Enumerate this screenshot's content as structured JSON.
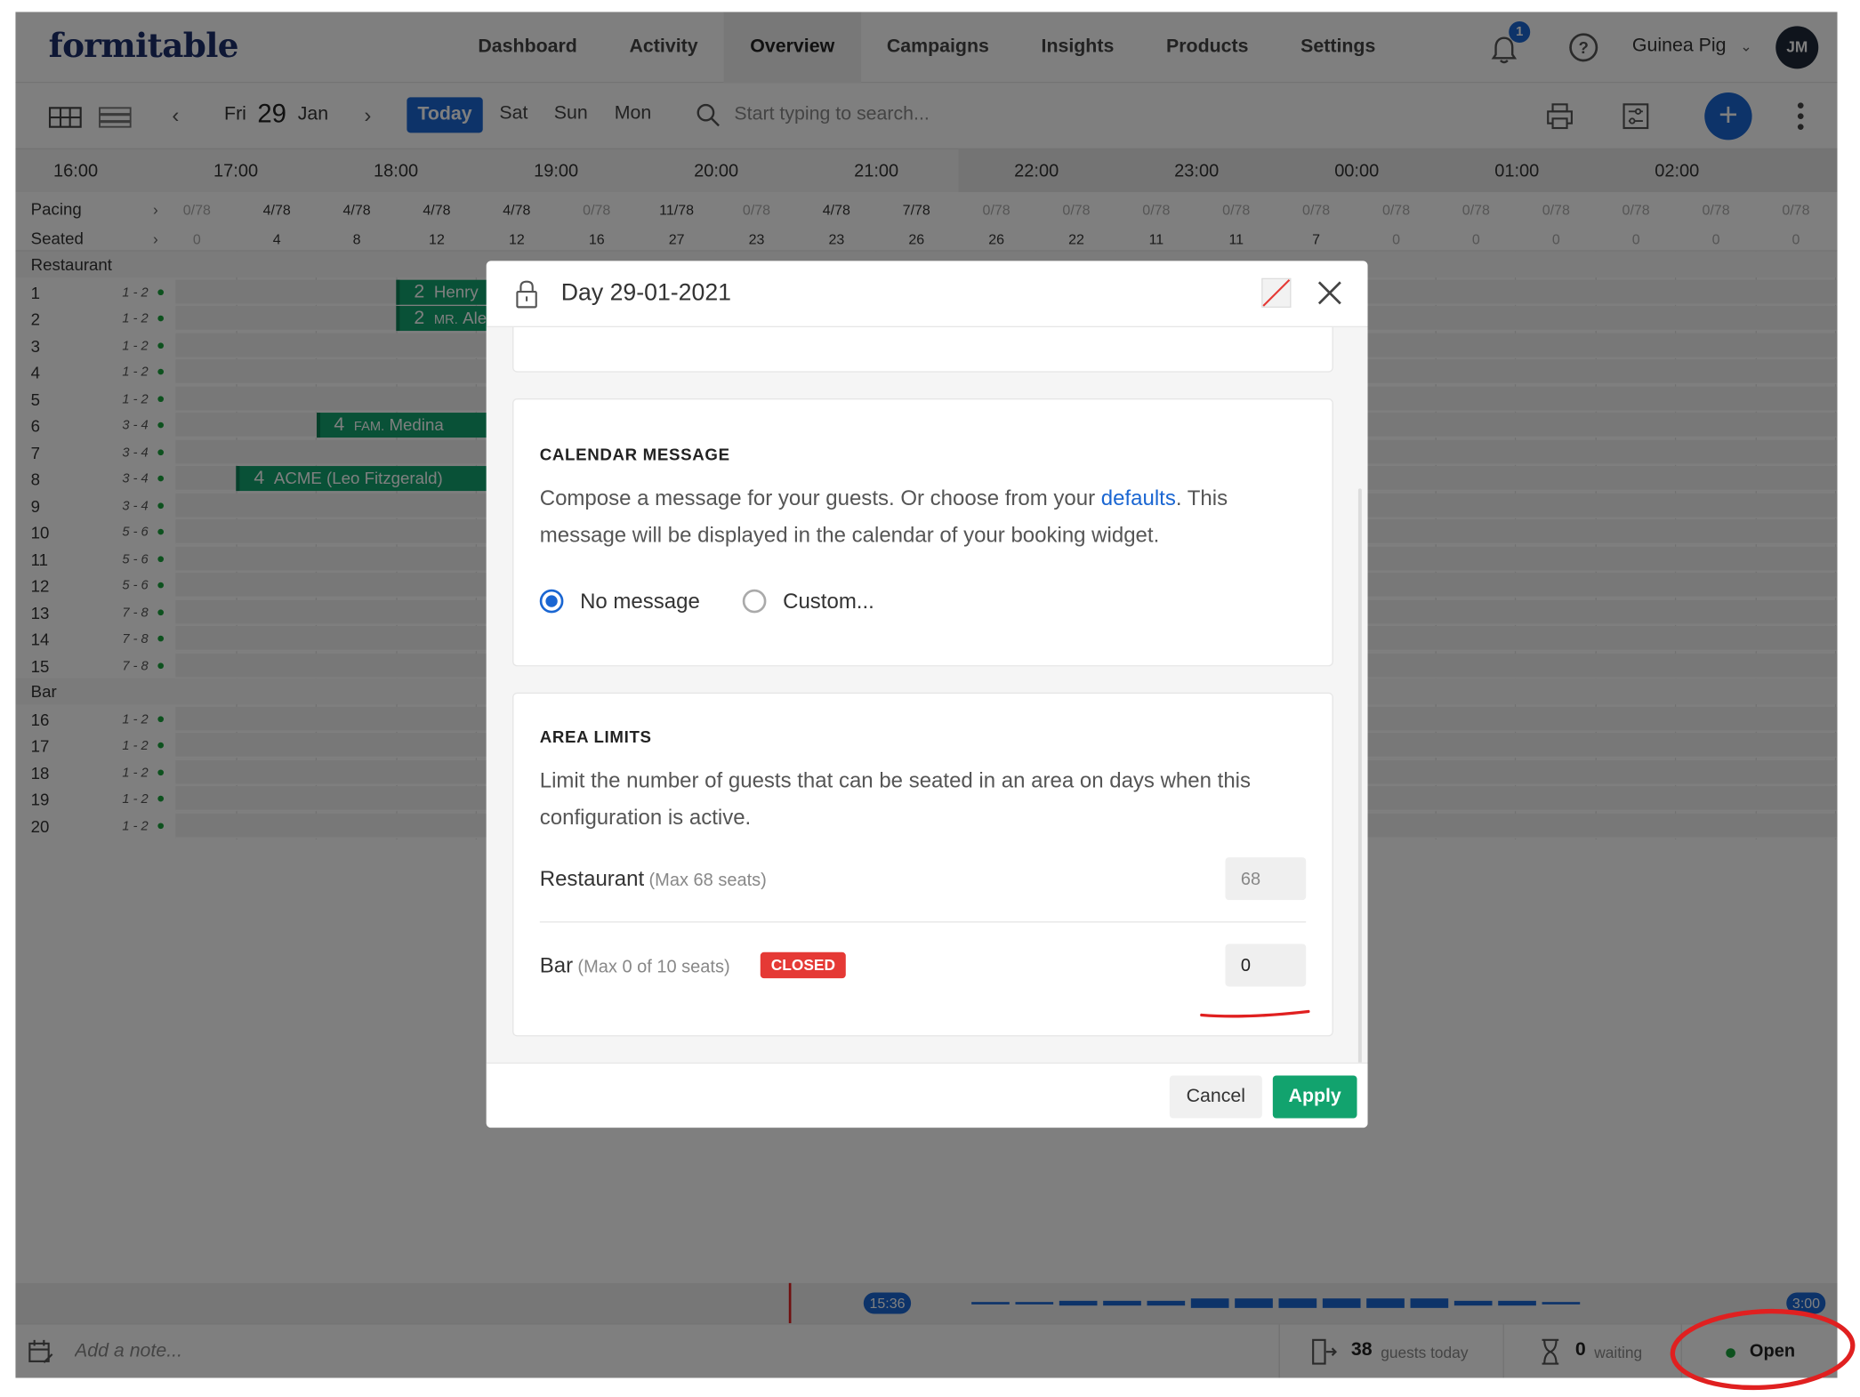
{
  "header": {
    "logo": "formitable",
    "nav": [
      {
        "label": "Dashboard",
        "active": false
      },
      {
        "label": "Activity",
        "active": false
      },
      {
        "label": "Overview",
        "active": true
      },
      {
        "label": "Campaigns",
        "active": false
      },
      {
        "label": "Insights",
        "active": false
      },
      {
        "label": "Products",
        "active": false
      },
      {
        "label": "Settings",
        "active": false
      }
    ],
    "notification_count": "1",
    "help_glyph": "?",
    "user_name": "Guinea Pig",
    "user_initials": "JM",
    "brand_color": "#1c2f6b",
    "accent_color": "#1a66d2"
  },
  "toolbar": {
    "date_day": "Fri",
    "date_num": "29",
    "date_month": "Jan",
    "today_label": "Today",
    "days": [
      "Sat",
      "Sun",
      "Mon"
    ],
    "search_placeholder": "Start typing to search...",
    "add_glyph": "+"
  },
  "timeline": {
    "hours": [
      "16:00",
      "17:00",
      "18:00",
      "19:00",
      "20:00",
      "21:00",
      "22:00",
      "23:00",
      "00:00",
      "01:00",
      "02:00"
    ],
    "pacing_label": "Pacing",
    "seated_label": "Seated",
    "pacing": [
      "0/78",
      "4/78",
      "4/78",
      "4/78",
      "4/78",
      "0/78",
      "11/78",
      "0/78",
      "4/78",
      "7/78",
      "0/78",
      "0/78",
      "0/78",
      "0/78",
      "0/78",
      "0/78",
      "0/78",
      "0/78",
      "0/78",
      "0/78",
      "0/78"
    ],
    "seated": [
      "0",
      "4",
      "8",
      "12",
      "12",
      "16",
      "27",
      "23",
      "23",
      "26",
      "26",
      "22",
      "11",
      "11",
      "7",
      "0",
      "0",
      "0",
      "0",
      "0",
      "0"
    ],
    "areas": [
      {
        "name": "Restaurant",
        "tables": [
          {
            "num": "1",
            "cap": "1 - 2"
          },
          {
            "num": "2",
            "cap": "1 - 2"
          },
          {
            "num": "3",
            "cap": "1 - 2"
          },
          {
            "num": "4",
            "cap": "1 - 2"
          },
          {
            "num": "5",
            "cap": "1 - 2"
          },
          {
            "num": "6",
            "cap": "3 - 4"
          },
          {
            "num": "7",
            "cap": "3 - 4"
          },
          {
            "num": "8",
            "cap": "3 - 4"
          },
          {
            "num": "9",
            "cap": "3 - 4"
          },
          {
            "num": "10",
            "cap": "5 - 6"
          },
          {
            "num": "11",
            "cap": "5 - 6"
          },
          {
            "num": "12",
            "cap": "5 - 6"
          },
          {
            "num": "13",
            "cap": "7 - 8"
          },
          {
            "num": "14",
            "cap": "7 - 8"
          },
          {
            "num": "15",
            "cap": "7 - 8"
          }
        ]
      },
      {
        "name": "Bar",
        "tables": [
          {
            "num": "16",
            "cap": "1 - 2"
          },
          {
            "num": "17",
            "cap": "1 - 2"
          },
          {
            "num": "18",
            "cap": "1 - 2"
          },
          {
            "num": "19",
            "cap": "1 - 2"
          },
          {
            "num": "20",
            "cap": "1 - 2"
          }
        ]
      }
    ],
    "bookings": [
      {
        "table_index": 0,
        "start": "18:00",
        "guests": "2",
        "prefix": "",
        "name": "Henry"
      },
      {
        "table_index": 1,
        "start": "18:00",
        "guests": "2",
        "prefix": "MR.",
        "name": "Ale"
      },
      {
        "table_index": 5,
        "start": "17:30",
        "guests": "4",
        "prefix": "FAM.",
        "name": "Medina"
      },
      {
        "table_index": 7,
        "start": "17:00",
        "guests": "4",
        "prefix": "",
        "name": "ACME (Leo Fitzgerald)"
      }
    ],
    "booking_color": "#12a36e"
  },
  "footer": {
    "start_time": "15:36",
    "end_time": "3:00",
    "note_placeholder": "Add a note...",
    "guests_count": "38",
    "guests_label": "guests today",
    "waiting_count": "0",
    "waiting_label": "waiting",
    "status": "Open",
    "status_color": "#1ba33d"
  },
  "modal": {
    "title": "Day 29-01-2021",
    "calendar": {
      "title": "CALENDAR MESSAGE",
      "desc_before": "Compose a message for your guests. Or choose from your ",
      "desc_link": "defaults",
      "desc_after": ". This message will be displayed in the calendar of your booking widget.",
      "options": [
        {
          "label": "No message",
          "checked": true
        },
        {
          "label": "Custom...",
          "checked": false
        }
      ]
    },
    "area_limits": {
      "title": "AREA LIMITS",
      "desc": "Limit the number of guests that can be seated in an area on days when this configuration is active.",
      "areas": [
        {
          "name": "Restaurant",
          "sub": "(Max 68 seats)",
          "value": "68",
          "badge": ""
        },
        {
          "name": "Bar",
          "sub": "(Max 0 of 10 seats)",
          "value": "0",
          "badge": "CLOSED"
        }
      ]
    },
    "cancel_label": "Cancel",
    "apply_label": "Apply",
    "apply_color": "#12a36e",
    "closed_color": "#e53935"
  },
  "annotations": {
    "color": "#e02020"
  }
}
